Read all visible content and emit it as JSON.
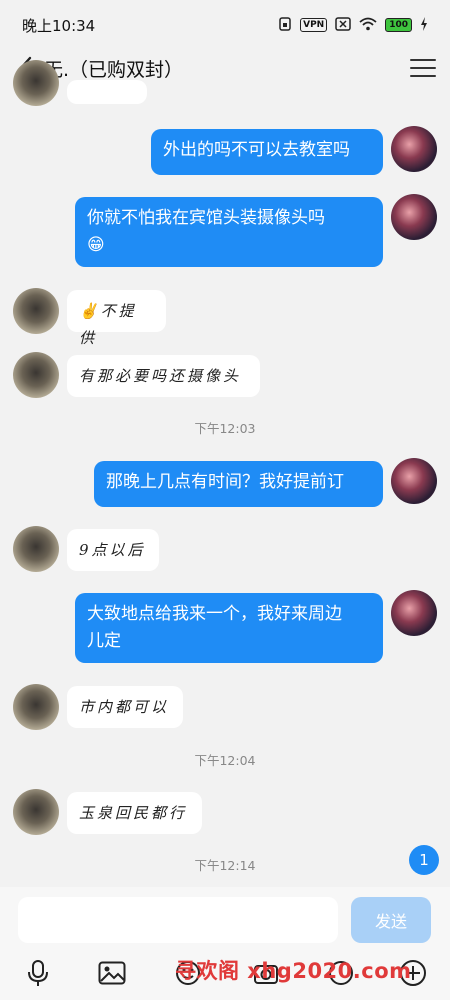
{
  "status": {
    "time": "晚上10:34",
    "vpn": "VPN",
    "battery": "100"
  },
  "header": {
    "title": "无.（已购双封）"
  },
  "messages": [
    {
      "side": "me",
      "text": "外出的吗不可以去教室吗"
    },
    {
      "side": "me",
      "text": "你就不怕我在宾馆头装摄像头吗",
      "emoji": "😁"
    },
    {
      "side": "other",
      "text": "✌不提供"
    },
    {
      "side": "other",
      "text": "有那必要吗还摄像头"
    },
    {
      "side": "me",
      "text": "那晚上几点有时间？我好提前订"
    },
    {
      "side": "other",
      "text": "9点以后"
    },
    {
      "side": "me",
      "text": "大致地点给我来一个，我好来周边",
      "text2": "儿定"
    },
    {
      "side": "other",
      "text": "市内都可以"
    },
    {
      "side": "other",
      "text": "玉泉回民都行"
    }
  ],
  "timestamps": [
    "下午12:03",
    "下午12:04",
    "下午12:14"
  ],
  "unread_count": "1",
  "input": {
    "placeholder": "",
    "send_label": "发送"
  },
  "watermark": "寻欢阁 xhg2020.com",
  "colors": {
    "accent": "#1f8cf5",
    "send_disabled": "#a9d0f7",
    "background": "#f2f2f2"
  },
  "icons": [
    "back-arrow-icon",
    "menu-icon",
    "microphone-icon",
    "image-icon",
    "emoji-icon",
    "add-icon"
  ]
}
